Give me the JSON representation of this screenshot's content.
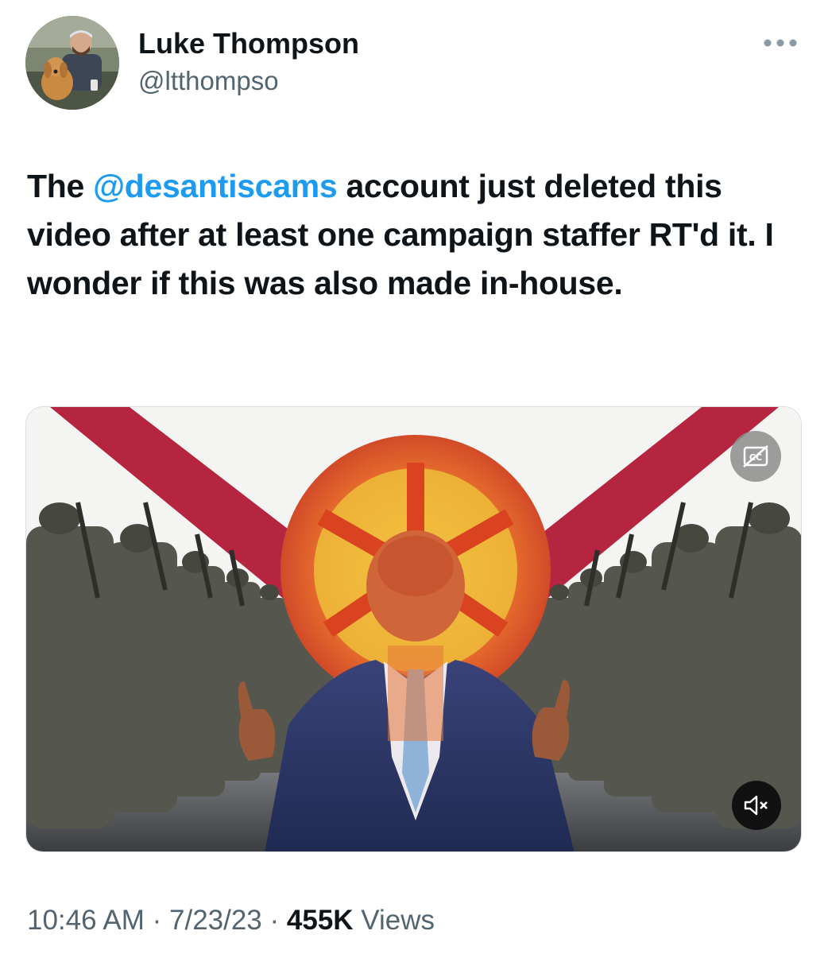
{
  "author": {
    "display_name": "Luke Thompson",
    "handle": "@ltthompso"
  },
  "tweet": {
    "text_before": "The ",
    "mention": "@desantiscams",
    "text_after": " account just deleted this video after at least one campaign staffer RT'd it. I wonder if this was also made in-house."
  },
  "media": {
    "cc_icon": "captions-off-icon",
    "mute_icon": "muted-speaker-icon"
  },
  "meta": {
    "time": "10:46 AM",
    "separator": " · ",
    "date": "7/23/23",
    "views_count": "455K",
    "views_label": " Views"
  },
  "colors": {
    "link": "#1d9bf0",
    "secondary_text": "#536471",
    "flag_red": "#b5253f"
  }
}
